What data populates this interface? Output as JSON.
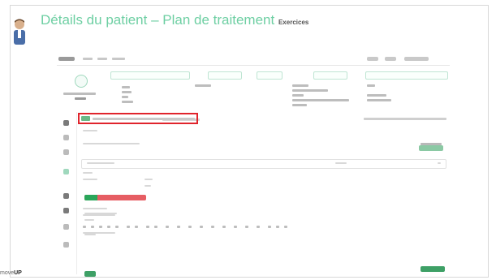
{
  "slide": {
    "title": "Détails du patient – Plan de traitement",
    "subtitle": "Exercices",
    "logo_prefix": "move",
    "logo_suffix": "UP"
  },
  "colors": {
    "title": "#6ecfa3",
    "highlight_box": "#e0242c",
    "primary_button": "#3ea066",
    "danger_button": "#e65d63"
  },
  "icons": [
    "user-avatar-icon",
    "sidebar-nav-icons"
  ]
}
